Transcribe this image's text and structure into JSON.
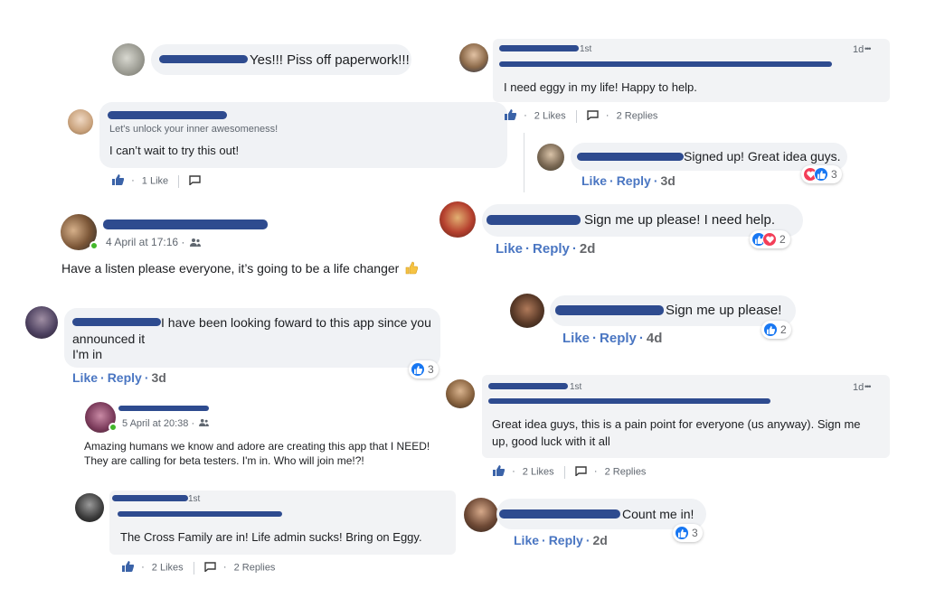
{
  "comments": {
    "c1": {
      "text": "Yes!!! Piss off paperwork!!!"
    },
    "c2": {
      "sub": "Let's unlock your inner awesomeness!",
      "text": "I can’t wait to try this out!",
      "likes": "1 Like"
    },
    "c3": {
      "date": "4 April at 17:16 ·",
      "text": "Have a listen please everyone, it’s going to be a life changer"
    },
    "c4": {
      "text1": "I have been looking foward to this app since you",
      "text2": "announced it",
      "text3": "I'm in",
      "like": "Like",
      "reply": "Reply",
      "time": "3d",
      "count": "3"
    },
    "c5": {
      "date": "5 April at 20:38 ·",
      "text1": "Amazing humans we know and adore are creating this app that I NEED!",
      "text2": "They are calling for beta testers. I'm in. Who will join me!?!"
    },
    "c6": {
      "badge": "1st",
      "text": "The Cross Family are in! Life admin sucks! Bring on Eggy.",
      "likes": "2 Likes",
      "replies": "2 Replies"
    },
    "c7": {
      "badge": "1st",
      "time": "1d",
      "more": "•••",
      "text": "I need eggy in my life! Happy to help.",
      "likes": "2 Likes",
      "replies": "2 Replies"
    },
    "c8": {
      "text": "Signed up! Great idea guys.",
      "like": "Like",
      "reply": "Reply",
      "time": "3d",
      "count": "3"
    },
    "c9": {
      "text": "Sign me up please! I need help.",
      "like": "Like",
      "reply": "Reply",
      "time": "2d",
      "count": "2"
    },
    "c10": {
      "text": "Sign me up please!",
      "like": "Like",
      "reply": "Reply",
      "time": "4d",
      "count": "2"
    },
    "c11": {
      "badge": "1st",
      "time": "1d",
      "more": "•••",
      "text1": "Great idea guys, this is a pain point for everyone (us anyway). Sign me",
      "text2": "up, good luck with it all",
      "likes": "2 Likes",
      "replies": "2 Replies"
    },
    "c12": {
      "text": "Count me in!",
      "like": "Like",
      "reply": "Reply",
      "time": "2d",
      "count": "3"
    }
  },
  "colors": {
    "like_blue": "#1877f2",
    "link_blue": "#4a76c2",
    "heart_red": "#f33e58",
    "redaction": "#2e4b8f",
    "bubble": "#f0f2f5"
  },
  "icons": {
    "like": "thumbs-up-icon",
    "comment": "comment-icon",
    "friends": "friends-icon",
    "heart": "heart-icon"
  }
}
